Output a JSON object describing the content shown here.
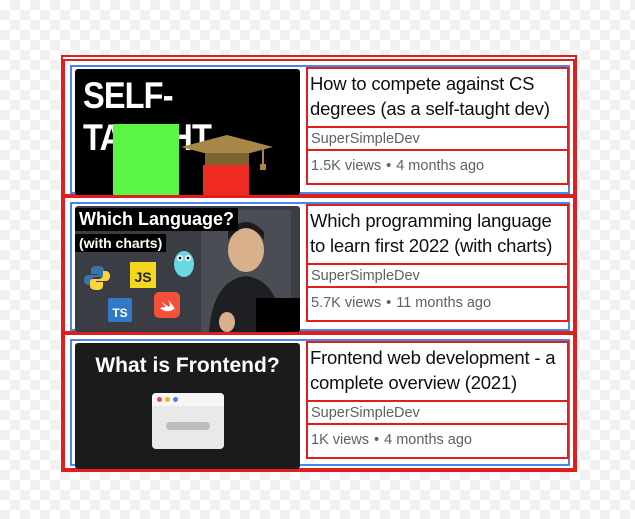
{
  "videos": [
    {
      "thumbnail_text": "SELF-TAUGHT",
      "title": "How to compete against CS degrees (as a self-taught dev)",
      "channel": "SuperSimpleDev",
      "views": "1.5K views",
      "age": "4 months ago"
    },
    {
      "thumbnail_text": "Which Language?",
      "thumbnail_subtext": "(with charts)",
      "badge_js": "JS",
      "badge_ts": "TS",
      "title": "Which programming language to learn first 2022 (with charts)",
      "channel": "SuperSimpleDev",
      "views": "5.7K views",
      "age": "11 months ago"
    },
    {
      "thumbnail_text": "What is Frontend?",
      "title": "Frontend web development - a complete overview (2021)",
      "channel": "SuperSimpleDev",
      "views": "1K views",
      "age": "4 months ago"
    }
  ],
  "separator": "•",
  "colors": {
    "outline_red": "#e01e1e",
    "outline_blue": "#4a86e8",
    "title_text": "#0f0f0f",
    "meta_text": "#606060"
  }
}
